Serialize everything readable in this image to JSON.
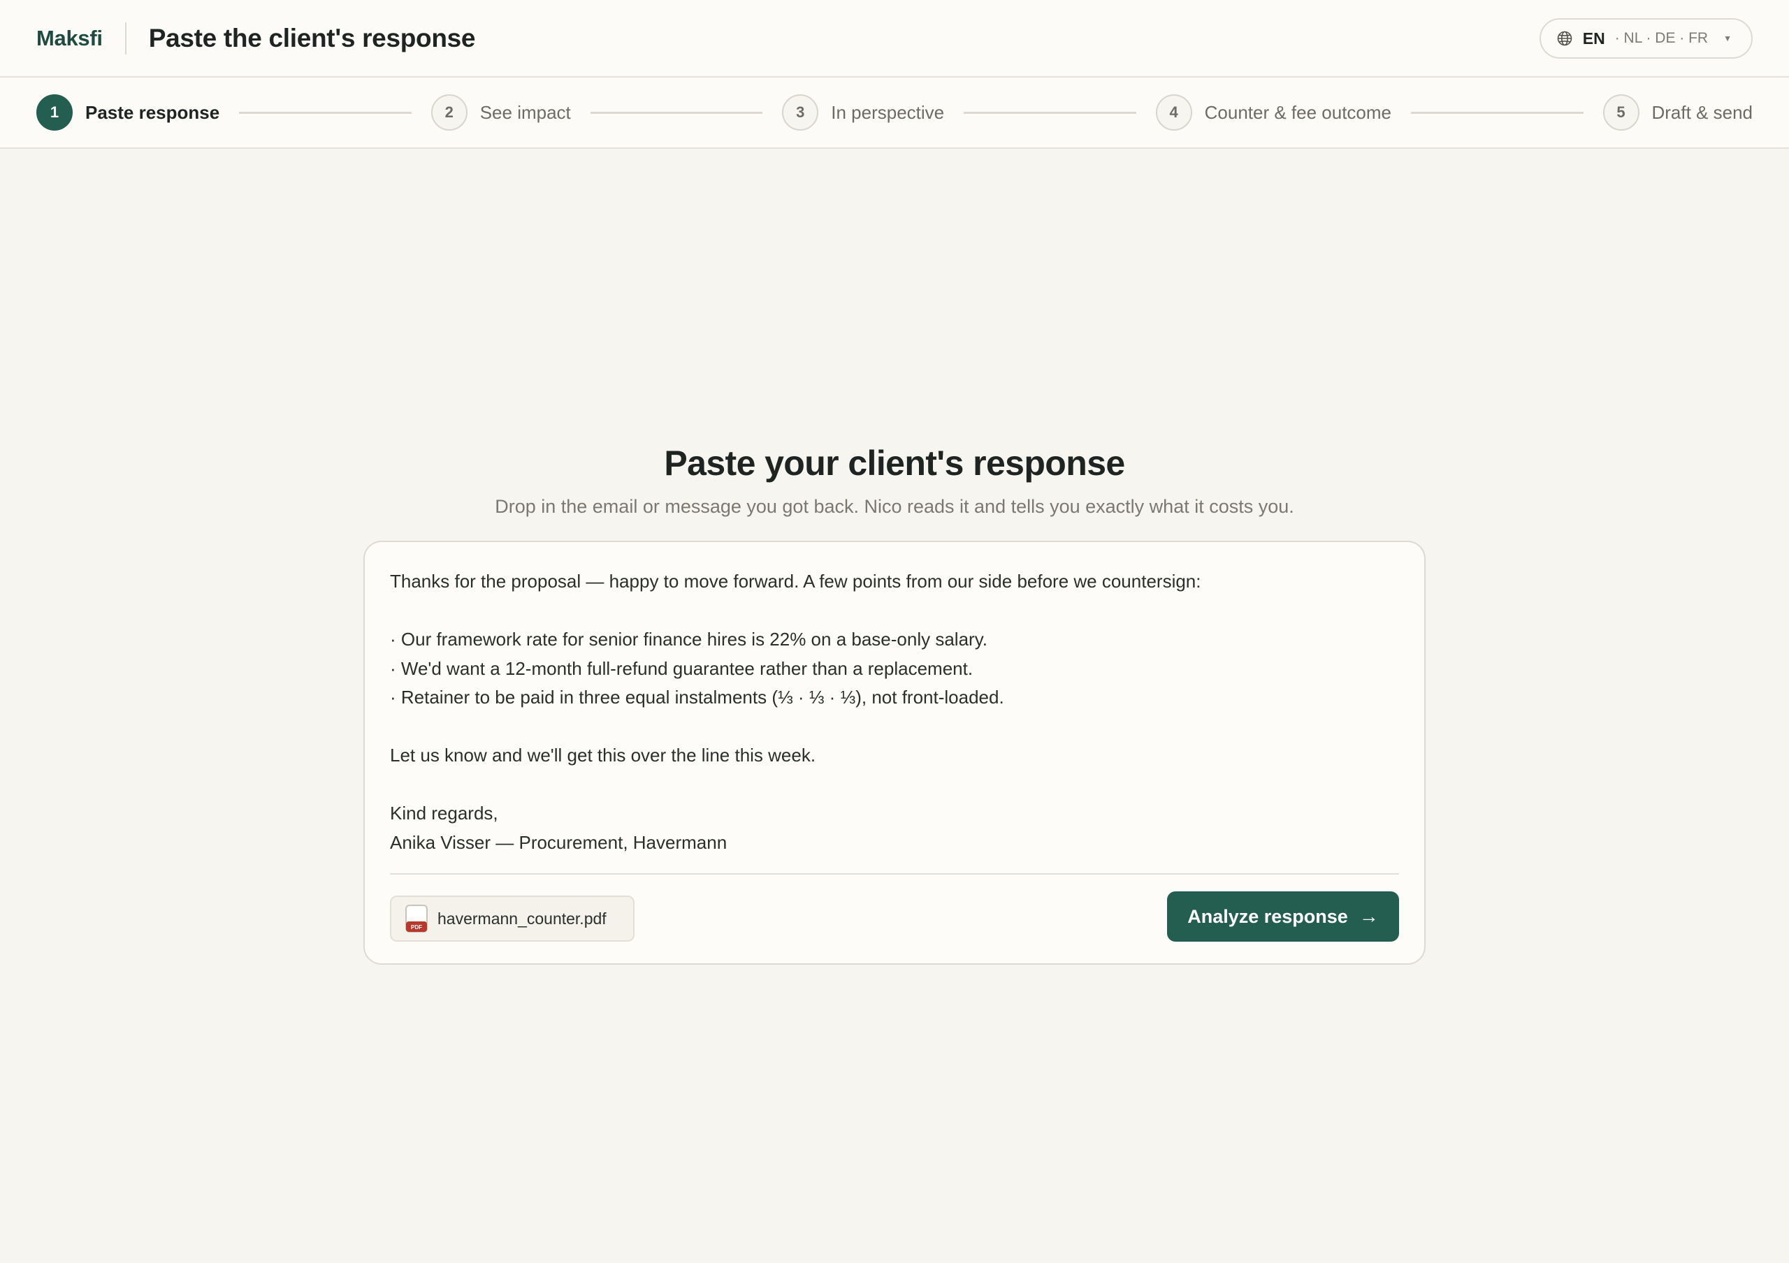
{
  "header": {
    "brand": "Maksfi",
    "title": "Paste the client's response",
    "language": {
      "active": "EN",
      "others": "· NL · DE · FR",
      "icon": "globe-icon"
    }
  },
  "stepper": {
    "steps": [
      {
        "num": "1",
        "label": "Paste response",
        "active": true
      },
      {
        "num": "2",
        "label": "See impact",
        "active": false
      },
      {
        "num": "3",
        "label": "In perspective",
        "active": false
      },
      {
        "num": "4",
        "label": "Counter & fee outcome",
        "active": false
      },
      {
        "num": "5",
        "label": "Draft & send",
        "active": false
      }
    ]
  },
  "main": {
    "heading": "Paste your client's response",
    "subheading": "Drop in the email or message you got back. Nico reads it and tells you exactly what it costs you."
  },
  "response": {
    "line_intro": "Thanks for the proposal — happy to move forward. A few points from our side before we countersign:",
    "bullet_1": "· Our framework rate for senior finance hires is 22% on a base-only salary.",
    "bullet_2": "· We'd want a 12-month full-refund guarantee rather than a replacement.",
    "bullet_3": "· Retainer to be paid in three equal instalments (⅓ · ⅓ · ⅓), not front-loaded.",
    "line_closing": "Let us know and we'll get this over the line this week.",
    "sign_off": "Kind regards,",
    "signature": "Anika Visser — Procurement, Havermann"
  },
  "attachment": {
    "filename": "havermann_counter.pdf",
    "icon": "pdf-icon",
    "badge": "PDF"
  },
  "actions": {
    "analyze_label": "Analyze response",
    "analyze_arrow": "→"
  },
  "colors": {
    "accent": "#245e51",
    "brand": "#1f4a40",
    "background": "#f7f5f0",
    "pdf_red": "#b8382c"
  }
}
